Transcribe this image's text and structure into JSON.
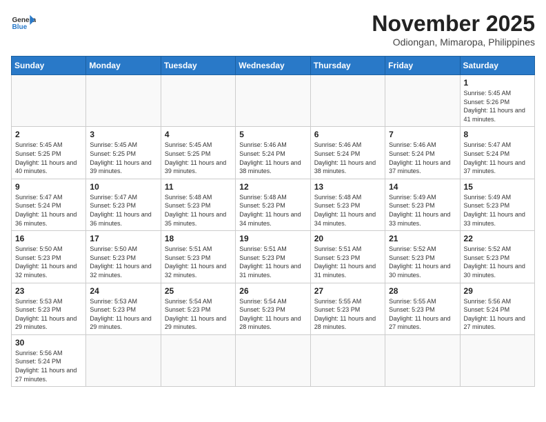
{
  "header": {
    "logo_general": "General",
    "logo_blue": "Blue",
    "month_title": "November 2025",
    "location": "Odiongan, Mimaropa, Philippines"
  },
  "weekdays": [
    "Sunday",
    "Monday",
    "Tuesday",
    "Wednesday",
    "Thursday",
    "Friday",
    "Saturday"
  ],
  "weeks": [
    [
      null,
      null,
      null,
      null,
      null,
      null,
      {
        "day": "1",
        "sunrise": "Sunrise: 5:45 AM",
        "sunset": "Sunset: 5:26 PM",
        "daylight": "Daylight: 11 hours and 41 minutes."
      }
    ],
    [
      {
        "day": "2",
        "sunrise": "Sunrise: 5:45 AM",
        "sunset": "Sunset: 5:25 PM",
        "daylight": "Daylight: 11 hours and 40 minutes."
      },
      {
        "day": "3",
        "sunrise": "Sunrise: 5:45 AM",
        "sunset": "Sunset: 5:25 PM",
        "daylight": "Daylight: 11 hours and 39 minutes."
      },
      {
        "day": "4",
        "sunrise": "Sunrise: 5:45 AM",
        "sunset": "Sunset: 5:25 PM",
        "daylight": "Daylight: 11 hours and 39 minutes."
      },
      {
        "day": "5",
        "sunrise": "Sunrise: 5:46 AM",
        "sunset": "Sunset: 5:24 PM",
        "daylight": "Daylight: 11 hours and 38 minutes."
      },
      {
        "day": "6",
        "sunrise": "Sunrise: 5:46 AM",
        "sunset": "Sunset: 5:24 PM",
        "daylight": "Daylight: 11 hours and 38 minutes."
      },
      {
        "day": "7",
        "sunrise": "Sunrise: 5:46 AM",
        "sunset": "Sunset: 5:24 PM",
        "daylight": "Daylight: 11 hours and 37 minutes."
      },
      {
        "day": "8",
        "sunrise": "Sunrise: 5:47 AM",
        "sunset": "Sunset: 5:24 PM",
        "daylight": "Daylight: 11 hours and 37 minutes."
      }
    ],
    [
      {
        "day": "9",
        "sunrise": "Sunrise: 5:47 AM",
        "sunset": "Sunset: 5:24 PM",
        "daylight": "Daylight: 11 hours and 36 minutes."
      },
      {
        "day": "10",
        "sunrise": "Sunrise: 5:47 AM",
        "sunset": "Sunset: 5:23 PM",
        "daylight": "Daylight: 11 hours and 36 minutes."
      },
      {
        "day": "11",
        "sunrise": "Sunrise: 5:48 AM",
        "sunset": "Sunset: 5:23 PM",
        "daylight": "Daylight: 11 hours and 35 minutes."
      },
      {
        "day": "12",
        "sunrise": "Sunrise: 5:48 AM",
        "sunset": "Sunset: 5:23 PM",
        "daylight": "Daylight: 11 hours and 34 minutes."
      },
      {
        "day": "13",
        "sunrise": "Sunrise: 5:48 AM",
        "sunset": "Sunset: 5:23 PM",
        "daylight": "Daylight: 11 hours and 34 minutes."
      },
      {
        "day": "14",
        "sunrise": "Sunrise: 5:49 AM",
        "sunset": "Sunset: 5:23 PM",
        "daylight": "Daylight: 11 hours and 33 minutes."
      },
      {
        "day": "15",
        "sunrise": "Sunrise: 5:49 AM",
        "sunset": "Sunset: 5:23 PM",
        "daylight": "Daylight: 11 hours and 33 minutes."
      }
    ],
    [
      {
        "day": "16",
        "sunrise": "Sunrise: 5:50 AM",
        "sunset": "Sunset: 5:23 PM",
        "daylight": "Daylight: 11 hours and 32 minutes."
      },
      {
        "day": "17",
        "sunrise": "Sunrise: 5:50 AM",
        "sunset": "Sunset: 5:23 PM",
        "daylight": "Daylight: 11 hours and 32 minutes."
      },
      {
        "day": "18",
        "sunrise": "Sunrise: 5:51 AM",
        "sunset": "Sunset: 5:23 PM",
        "daylight": "Daylight: 11 hours and 32 minutes."
      },
      {
        "day": "19",
        "sunrise": "Sunrise: 5:51 AM",
        "sunset": "Sunset: 5:23 PM",
        "daylight": "Daylight: 11 hours and 31 minutes."
      },
      {
        "day": "20",
        "sunrise": "Sunrise: 5:51 AM",
        "sunset": "Sunset: 5:23 PM",
        "daylight": "Daylight: 11 hours and 31 minutes."
      },
      {
        "day": "21",
        "sunrise": "Sunrise: 5:52 AM",
        "sunset": "Sunset: 5:23 PM",
        "daylight": "Daylight: 11 hours and 30 minutes."
      },
      {
        "day": "22",
        "sunrise": "Sunrise: 5:52 AM",
        "sunset": "Sunset: 5:23 PM",
        "daylight": "Daylight: 11 hours and 30 minutes."
      }
    ],
    [
      {
        "day": "23",
        "sunrise": "Sunrise: 5:53 AM",
        "sunset": "Sunset: 5:23 PM",
        "daylight": "Daylight: 11 hours and 29 minutes."
      },
      {
        "day": "24",
        "sunrise": "Sunrise: 5:53 AM",
        "sunset": "Sunset: 5:23 PM",
        "daylight": "Daylight: 11 hours and 29 minutes."
      },
      {
        "day": "25",
        "sunrise": "Sunrise: 5:54 AM",
        "sunset": "Sunset: 5:23 PM",
        "daylight": "Daylight: 11 hours and 29 minutes."
      },
      {
        "day": "26",
        "sunrise": "Sunrise: 5:54 AM",
        "sunset": "Sunset: 5:23 PM",
        "daylight": "Daylight: 11 hours and 28 minutes."
      },
      {
        "day": "27",
        "sunrise": "Sunrise: 5:55 AM",
        "sunset": "Sunset: 5:23 PM",
        "daylight": "Daylight: 11 hours and 28 minutes."
      },
      {
        "day": "28",
        "sunrise": "Sunrise: 5:55 AM",
        "sunset": "Sunset: 5:23 PM",
        "daylight": "Daylight: 11 hours and 27 minutes."
      },
      {
        "day": "29",
        "sunrise": "Sunrise: 5:56 AM",
        "sunset": "Sunset: 5:24 PM",
        "daylight": "Daylight: 11 hours and 27 minutes."
      }
    ],
    [
      {
        "day": "30",
        "sunrise": "Sunrise: 5:56 AM",
        "sunset": "Sunset: 5:24 PM",
        "daylight": "Daylight: 11 hours and 27 minutes."
      },
      null,
      null,
      null,
      null,
      null,
      null
    ]
  ]
}
